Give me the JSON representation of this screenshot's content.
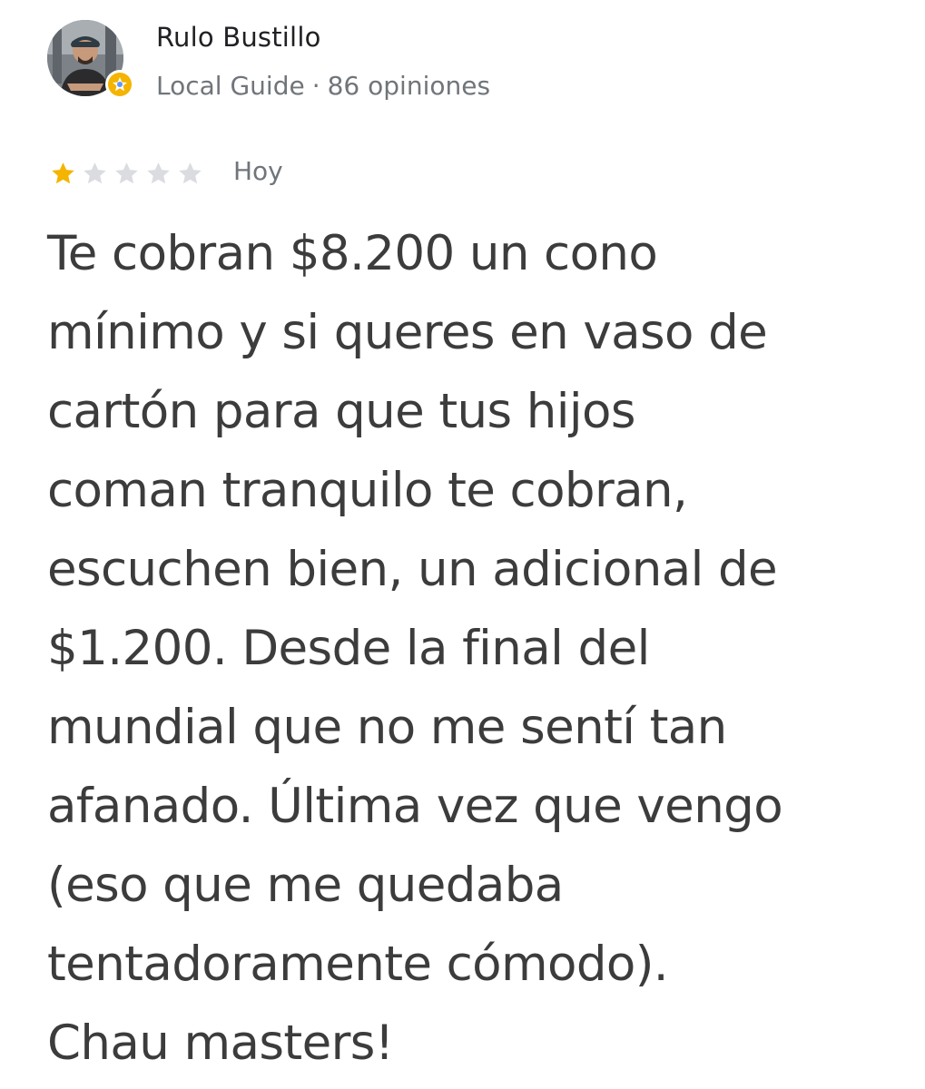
{
  "author": {
    "name": "Rulo Bustillo",
    "badge": "Local Guide",
    "separator": "·",
    "reviews_count": "86 opiniones"
  },
  "review": {
    "rating": 1,
    "max_rating": 5,
    "date": "Hoy",
    "text_lines": [
      "Te cobran $8.200 un cono",
      "mínimo y si queres en vaso de",
      "cartón para que tus hijos",
      "coman tranquilo te cobran,",
      "escuchen bien, un adicional de",
      "$1.200. Desde la final del",
      "mundial que no me sentí tan",
      "afanado. Última vez que vengo",
      "(eso que me quedaba",
      "tentadoramente cómodo).",
      "Chau masters!"
    ]
  },
  "colors": {
    "star_filled": "#f4b400",
    "star_empty": "#dadce0",
    "badge": "#f4b400",
    "meta_text": "#70757a",
    "body_text": "#3c3c3c"
  },
  "icons": {
    "avatar": "user-photo",
    "badge": "local-guide-star-badge",
    "star": "star-icon"
  }
}
